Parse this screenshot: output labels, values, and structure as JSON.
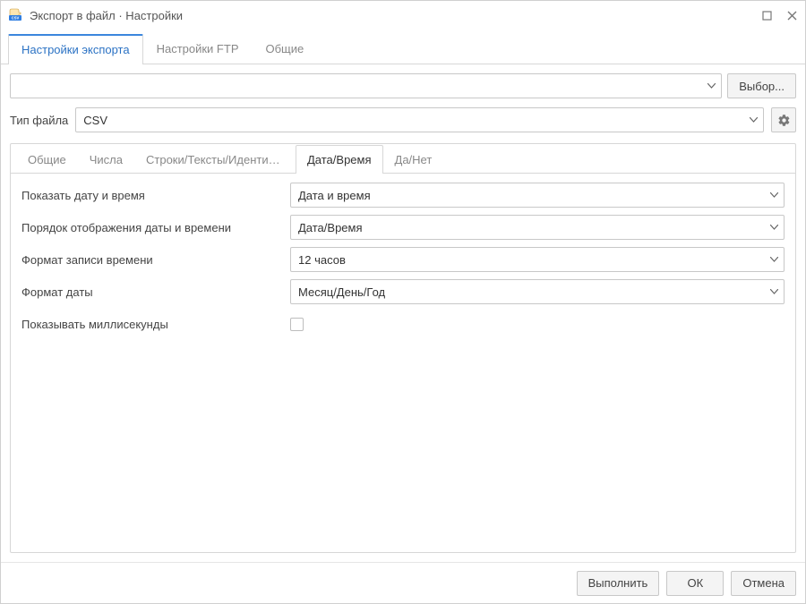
{
  "window": {
    "title": "Экспорт в файл · Настройки"
  },
  "main_tabs": {
    "items": [
      {
        "label": "Настройки экспорта",
        "active": true
      },
      {
        "label": "Настройки FTP",
        "active": false
      },
      {
        "label": "Общие",
        "active": false
      }
    ]
  },
  "top_selector": {
    "value": "",
    "choose_button": "Выбор..."
  },
  "file_type": {
    "label": "Тип файла",
    "value": "CSV"
  },
  "sub_tabs": {
    "items": [
      {
        "label": "Общие",
        "active": false
      },
      {
        "label": "Числа",
        "active": false
      },
      {
        "label": "Строки/Тексты/Идентифик...",
        "active": false
      },
      {
        "label": "Дата/Время",
        "active": true
      },
      {
        "label": "Да/Нет",
        "active": false
      }
    ]
  },
  "settings": {
    "show_datetime": {
      "label": "Показать дату и время",
      "value": "Дата и время"
    },
    "order": {
      "label": "Порядок отображения даты и времени",
      "value": "Дата/Время"
    },
    "time_format": {
      "label": "Формат записи времени",
      "value": "12 часов"
    },
    "date_format": {
      "label": "Формат даты",
      "value": "Месяц/День/Год"
    },
    "show_ms": {
      "label": "Показывать миллисекунды",
      "checked": false
    }
  },
  "footer": {
    "run": "Выполнить",
    "ok": "ОК",
    "cancel": "Отмена"
  }
}
